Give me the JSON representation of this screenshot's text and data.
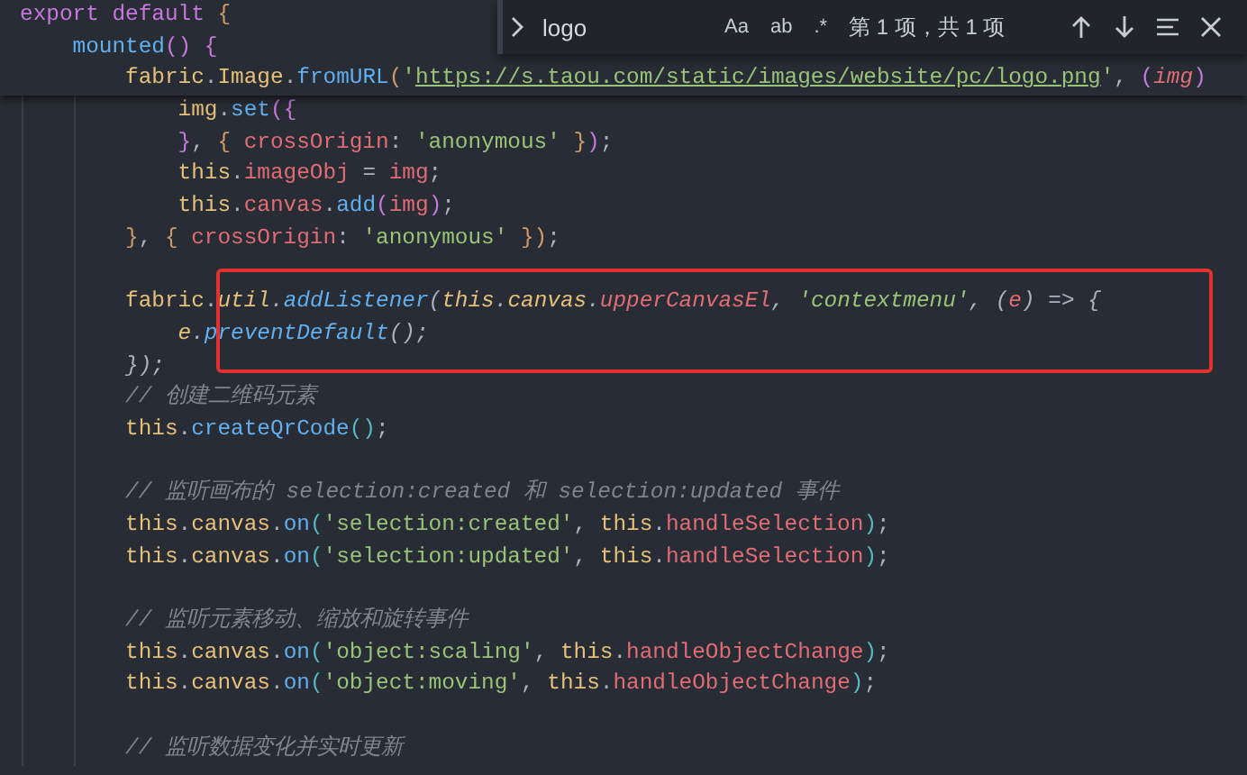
{
  "find_widget": {
    "value": "logo",
    "options": [
      {
        "label": "Aa",
        "selected": false
      },
      {
        "label": "ab",
        "selected": false
      },
      {
        "label": ".*",
        "selected": false
      }
    ],
    "result": "第 1 项，共 1 项"
  },
  "sticky_lines": [
    {
      "tokens": [
        {
          "text": "export ",
          "kind": "kw"
        },
        {
          "text": "default ",
          "kind": "kw"
        },
        {
          "text": "{",
          "kind": "brace"
        }
      ]
    },
    {
      "tokens": [
        {
          "text": "    mounted",
          "kind": "fn"
        },
        {
          "text": "() {",
          "kind": "paren"
        }
      ]
    },
    {
      "tokens": [
        {
          "text": "        fabric",
          "kind": "var"
        },
        {
          "text": ".",
          "kind": "punc"
        },
        {
          "text": "Image",
          "kind": "var"
        },
        {
          "text": ".",
          "kind": "punc"
        },
        {
          "text": "fromURL",
          "kind": "fn"
        },
        {
          "text": "(",
          "kind": "brace"
        },
        {
          "text": "'",
          "kind": "str"
        },
        {
          "text": "https://s.taou.com/static/images/website/pc/logo.png",
          "kind": "link"
        },
        {
          "text": "'",
          "kind": "str"
        },
        {
          "text": ", ",
          "kind": "punc"
        },
        {
          "text": "(",
          "kind": "paren"
        },
        {
          "text": "img",
          "kind": "param",
          "italic": true
        },
        {
          "text": ")",
          "kind": "paren"
        }
      ]
    }
  ],
  "lines": [
    {
      "tokens": [
        {
          "text": "            img",
          "kind": "var"
        },
        {
          "text": ".",
          "kind": "punc"
        },
        {
          "text": "set",
          "kind": "fn"
        },
        {
          "text": "({",
          "kind": "paren"
        }
      ]
    },
    {
      "tokens": [
        {
          "text": "            }",
          "kind": "paren"
        },
        {
          "text": ", ",
          "kind": "punc"
        },
        {
          "text": "{",
          "kind": "brace"
        },
        {
          "text": " crossOrigin",
          "kind": "prop"
        },
        {
          "text": ": ",
          "kind": "punc"
        },
        {
          "text": "'anonymous' ",
          "kind": "str"
        },
        {
          "text": "}",
          "kind": "brace"
        },
        {
          "text": ")",
          "kind": "paren"
        },
        {
          "text": ";",
          "kind": "punc"
        }
      ]
    },
    {
      "tokens": [
        {
          "text": "            this",
          "kind": "var"
        },
        {
          "text": ".",
          "kind": "punc"
        },
        {
          "text": "imageObj",
          "kind": "prop"
        },
        {
          "text": " = ",
          "kind": "punc"
        },
        {
          "text": "img",
          "kind": "prop"
        },
        {
          "text": ";",
          "kind": "punc"
        }
      ]
    },
    {
      "tokens": [
        {
          "text": "            this",
          "kind": "var"
        },
        {
          "text": ".",
          "kind": "punc"
        },
        {
          "text": "canvas",
          "kind": "prop"
        },
        {
          "text": ".",
          "kind": "punc"
        },
        {
          "text": "add",
          "kind": "fn"
        },
        {
          "text": "(",
          "kind": "paren"
        },
        {
          "text": "img",
          "kind": "prop"
        },
        {
          "text": ")",
          "kind": "paren"
        },
        {
          "text": ";",
          "kind": "punc"
        }
      ]
    },
    {
      "tokens": [
        {
          "text": "        }",
          "kind": "brace"
        },
        {
          "text": ", ",
          "kind": "punc"
        },
        {
          "text": "{",
          "kind": "brace"
        },
        {
          "text": " crossOrigin",
          "kind": "prop"
        },
        {
          "text": ": ",
          "kind": "punc"
        },
        {
          "text": "'anonymous' ",
          "kind": "str"
        },
        {
          "text": "}",
          "kind": "brace"
        },
        {
          "text": ")",
          "kind": "brace"
        },
        {
          "text": ";",
          "kind": "punc"
        }
      ]
    },
    {
      "kind": "blank"
    },
    {
      "boxed": true,
      "tokens": [
        {
          "text": "        fabric",
          "kind": "var"
        },
        {
          "text": ".",
          "kind": "punc"
        },
        {
          "text": "util",
          "kind": "var",
          "italic": true
        },
        {
          "text": ".",
          "kind": "punc",
          "italic": true
        },
        {
          "text": "addListener",
          "kind": "fn",
          "italic": true
        },
        {
          "text": "(",
          "kind": "punc",
          "italic": true
        },
        {
          "text": "this",
          "kind": "var",
          "italic": true
        },
        {
          "text": ".",
          "kind": "punc",
          "italic": true
        },
        {
          "text": "canvas",
          "kind": "var",
          "italic": true
        },
        {
          "text": ".",
          "kind": "punc",
          "italic": true
        },
        {
          "text": "upperCanvasEl",
          "kind": "prop",
          "italic": true
        },
        {
          "text": ", ",
          "kind": "punc",
          "italic": true
        },
        {
          "text": "'contextmenu'",
          "kind": "str",
          "italic": true
        },
        {
          "text": ", (",
          "kind": "punc",
          "italic": true
        },
        {
          "text": "e",
          "kind": "prop",
          "italic": true
        },
        {
          "text": ") => {",
          "kind": "punc",
          "italic": true
        }
      ]
    },
    {
      "boxed": true,
      "tokens": [
        {
          "text": "            e",
          "kind": "var",
          "italic": true
        },
        {
          "text": ".",
          "kind": "punc",
          "italic": true
        },
        {
          "text": "preventDefault",
          "kind": "fn",
          "italic": true
        },
        {
          "text": "();",
          "kind": "punc",
          "italic": true
        }
      ]
    },
    {
      "tokens": [
        {
          "text": "        });",
          "kind": "punc",
          "italic": true
        }
      ]
    },
    {
      "tokens": [
        {
          "text": "        // 创建二维码元素",
          "kind": "cmt"
        }
      ]
    },
    {
      "tokens": [
        {
          "text": "        this",
          "kind": "var"
        },
        {
          "text": ".",
          "kind": "punc"
        },
        {
          "text": "createQrCode",
          "kind": "fn"
        },
        {
          "text": "()",
          "kind": "brace2"
        },
        {
          "text": ";",
          "kind": "punc"
        }
      ]
    },
    {
      "kind": "blank"
    },
    {
      "tokens": [
        {
          "text": "        // 监听画布的 selection:created 和 selection:updated 事件",
          "kind": "cmt"
        }
      ]
    },
    {
      "tokens": [
        {
          "text": "        this",
          "kind": "var"
        },
        {
          "text": ".",
          "kind": "punc"
        },
        {
          "text": "canvas",
          "kind": "var"
        },
        {
          "text": ".",
          "kind": "punc"
        },
        {
          "text": "on",
          "kind": "fn"
        },
        {
          "text": "(",
          "kind": "brace2"
        },
        {
          "text": "'selection:created'",
          "kind": "str"
        },
        {
          "text": ", ",
          "kind": "punc"
        },
        {
          "text": "this",
          "kind": "var"
        },
        {
          "text": ".",
          "kind": "punc"
        },
        {
          "text": "handleSelection",
          "kind": "prop"
        },
        {
          "text": ")",
          "kind": "brace2"
        },
        {
          "text": ";",
          "kind": "punc"
        }
      ]
    },
    {
      "tokens": [
        {
          "text": "        this",
          "kind": "var"
        },
        {
          "text": ".",
          "kind": "punc"
        },
        {
          "text": "canvas",
          "kind": "var"
        },
        {
          "text": ".",
          "kind": "punc"
        },
        {
          "text": "on",
          "kind": "fn"
        },
        {
          "text": "(",
          "kind": "brace2"
        },
        {
          "text": "'selection:updated'",
          "kind": "str"
        },
        {
          "text": ", ",
          "kind": "punc"
        },
        {
          "text": "this",
          "kind": "var"
        },
        {
          "text": ".",
          "kind": "punc"
        },
        {
          "text": "handleSelection",
          "kind": "prop"
        },
        {
          "text": ")",
          "kind": "brace2"
        },
        {
          "text": ";",
          "kind": "punc"
        }
      ]
    },
    {
      "kind": "blank"
    },
    {
      "tokens": [
        {
          "text": "        // 监听元素移动、缩放和旋转事件",
          "kind": "cmt"
        }
      ]
    },
    {
      "tokens": [
        {
          "text": "        this",
          "kind": "var"
        },
        {
          "text": ".",
          "kind": "punc"
        },
        {
          "text": "canvas",
          "kind": "var"
        },
        {
          "text": ".",
          "kind": "punc"
        },
        {
          "text": "on",
          "kind": "fn"
        },
        {
          "text": "(",
          "kind": "brace2"
        },
        {
          "text": "'object:scaling'",
          "kind": "str"
        },
        {
          "text": ", ",
          "kind": "punc"
        },
        {
          "text": "this",
          "kind": "var"
        },
        {
          "text": ".",
          "kind": "punc"
        },
        {
          "text": "handleObjectChange",
          "kind": "prop"
        },
        {
          "text": ")",
          "kind": "brace2"
        },
        {
          "text": ";",
          "kind": "punc"
        }
      ]
    },
    {
      "tokens": [
        {
          "text": "        this",
          "kind": "var"
        },
        {
          "text": ".",
          "kind": "punc"
        },
        {
          "text": "canvas",
          "kind": "var"
        },
        {
          "text": ".",
          "kind": "punc"
        },
        {
          "text": "on",
          "kind": "fn"
        },
        {
          "text": "(",
          "kind": "brace2"
        },
        {
          "text": "'object:moving'",
          "kind": "str"
        },
        {
          "text": ", ",
          "kind": "punc"
        },
        {
          "text": "this",
          "kind": "var"
        },
        {
          "text": ".",
          "kind": "punc"
        },
        {
          "text": "handleObjectChange",
          "kind": "prop"
        },
        {
          "text": ")",
          "kind": "brace2"
        },
        {
          "text": ";",
          "kind": "punc"
        }
      ]
    },
    {
      "kind": "blank"
    },
    {
      "tokens": [
        {
          "text": "        // 监听数据变化并实时更新",
          "kind": "cmt"
        }
      ]
    }
  ]
}
